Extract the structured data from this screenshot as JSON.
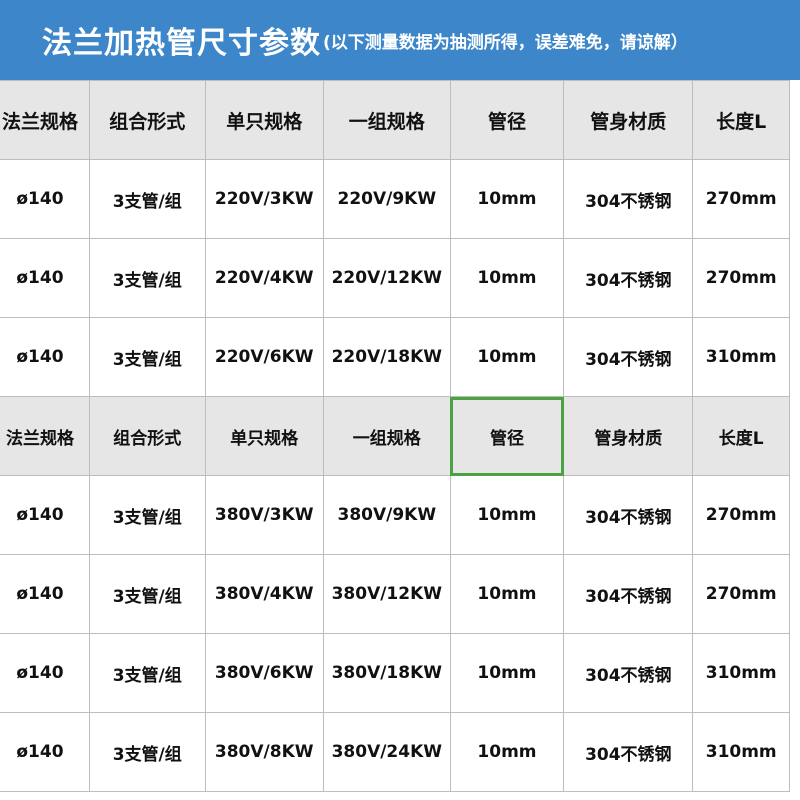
{
  "title": {
    "main": "法兰加热管尺寸参数",
    "note": "(以下测量数据为抽测所得，误差难免，请谅解）"
  },
  "section1": {
    "headers": [
      "法兰规格",
      "组合形式",
      "单只规格",
      "一组规格",
      "管径",
      "管身材质",
      "长度L"
    ],
    "rows": [
      [
        "ø140",
        "3支管/组",
        "220V/3KW",
        "220V/9KW",
        "10mm",
        "304不锈钢",
        "270mm"
      ],
      [
        "ø140",
        "3支管/组",
        "220V/4KW",
        "220V/12KW",
        "10mm",
        "304不锈钢",
        "270mm"
      ],
      [
        "ø140",
        "3支管/组",
        "220V/6KW",
        "220V/18KW",
        "10mm",
        "304不锈钢",
        "310mm"
      ]
    ]
  },
  "section2": {
    "headers": [
      "法兰规格",
      "组合形式",
      "单只规格",
      "一组规格",
      "管径",
      "管身材质",
      "长度L"
    ],
    "rows": [
      [
        "ø140",
        "3支管/组",
        "380V/3KW",
        "380V/9KW",
        "10mm",
        "304不锈钢",
        "270mm"
      ],
      [
        "ø140",
        "3支管/组",
        "380V/4KW",
        "380V/12KW",
        "10mm",
        "304不锈钢",
        "270mm"
      ],
      [
        "ø140",
        "3支管/组",
        "380V/6KW",
        "380V/18KW",
        "10mm",
        "304不锈钢",
        "310mm"
      ],
      [
        "ø140",
        "3支管/组",
        "380V/8KW",
        "380V/24KW",
        "10mm",
        "304不锈钢",
        "310mm"
      ]
    ]
  },
  "colors": {
    "title_bg": "#3c86c9",
    "header_bg": "#e6e6e6",
    "selection": "#4aa243"
  }
}
